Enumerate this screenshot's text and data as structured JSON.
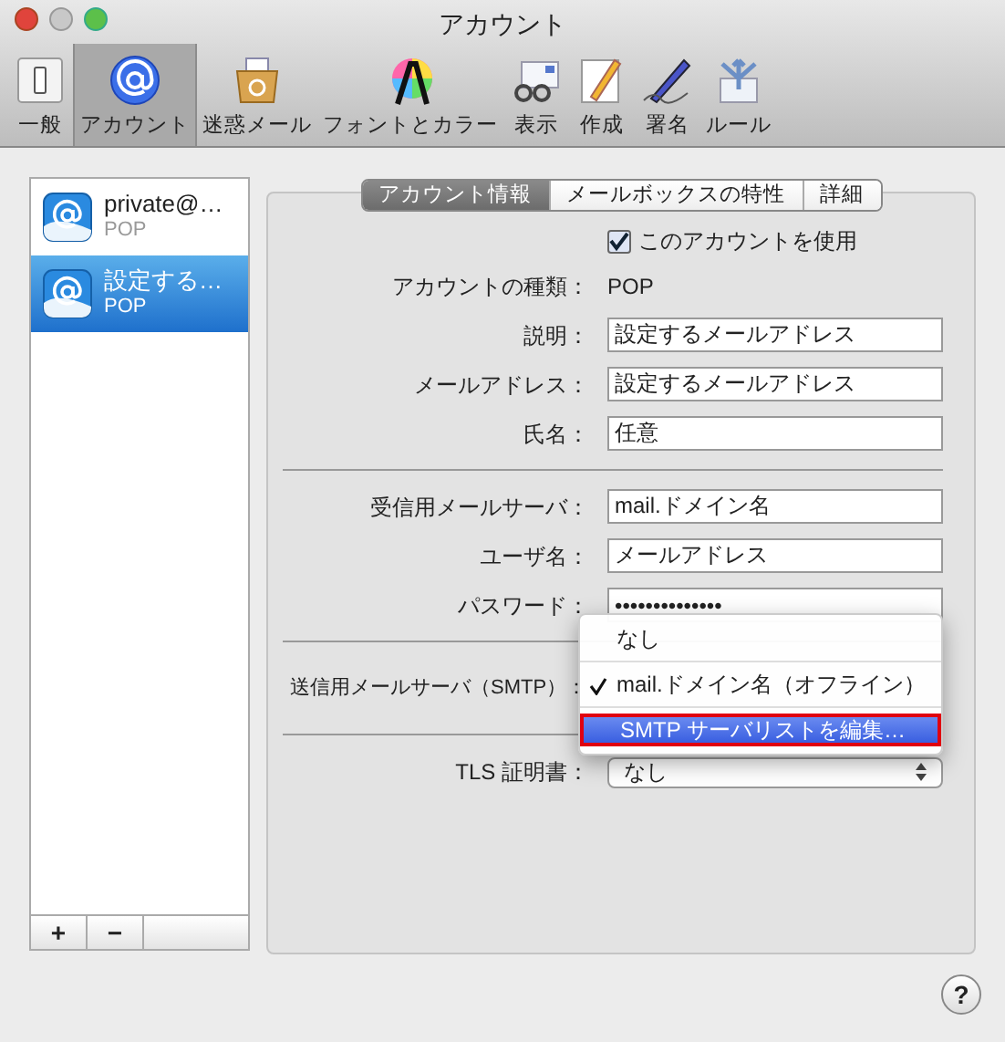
{
  "window": {
    "title": "アカウント"
  },
  "toolbar": {
    "items": [
      {
        "label": "一般",
        "selected": false
      },
      {
        "label": "アカウント",
        "selected": true
      },
      {
        "label": "迷惑メール",
        "selected": false
      },
      {
        "label": "フォントとカラー",
        "selected": false
      },
      {
        "label": "表示",
        "selected": false
      },
      {
        "label": "作成",
        "selected": false
      },
      {
        "label": "署名",
        "selected": false
      },
      {
        "label": "ルール",
        "selected": false
      }
    ]
  },
  "accounts": [
    {
      "name": "private@…",
      "type": "POP",
      "selected": false
    },
    {
      "name": "設定する…",
      "type": "POP",
      "selected": true
    }
  ],
  "list_buttons": [
    "+",
    "−"
  ],
  "tabs": [
    {
      "label": "アカウント情報",
      "selected": true
    },
    {
      "label": "メールボックスの特性",
      "selected": false
    },
    {
      "label": "詳細",
      "selected": false
    }
  ],
  "sections": [
    {
      "rows": [
        {
          "kind": "checkbox",
          "label": "このアカウントを使用",
          "checked": true
        },
        {
          "kind": "static",
          "label": "アカウントの種類：",
          "value": "POP"
        },
        {
          "kind": "text",
          "label": "説明：",
          "value": "設定するメールアドレス"
        },
        {
          "kind": "text",
          "label": "メールアドレス：",
          "value": "設定するメールアドレス"
        },
        {
          "kind": "text",
          "label": "氏名：",
          "value": "任意"
        }
      ]
    },
    {
      "rows": [
        {
          "kind": "text",
          "label": "受信用メールサーバ：",
          "value": "mail.ドメイン名"
        },
        {
          "kind": "text",
          "label": "ユーザ名：",
          "value": "メールアドレス"
        },
        {
          "kind": "text",
          "label": "パスワード：",
          "value": "••••••••••••••"
        }
      ]
    },
    {
      "rows": [
        {
          "kind": "popup",
          "label": "送信用メールサーバ（SMTP）："
        }
      ]
    },
    {
      "rows": [
        {
          "kind": "select",
          "label": "TLS 証明書：",
          "value": "なし"
        }
      ]
    }
  ],
  "popup_menu": {
    "items": [
      {
        "label": "なし",
        "checked": false,
        "selected": false
      },
      {
        "label": "mail.ドメイン名（オフライン）",
        "checked": true,
        "selected": false
      },
      {
        "label": "SMTP サーバリストを編集…",
        "checked": false,
        "selected": true
      }
    ]
  },
  "help_button": "?"
}
